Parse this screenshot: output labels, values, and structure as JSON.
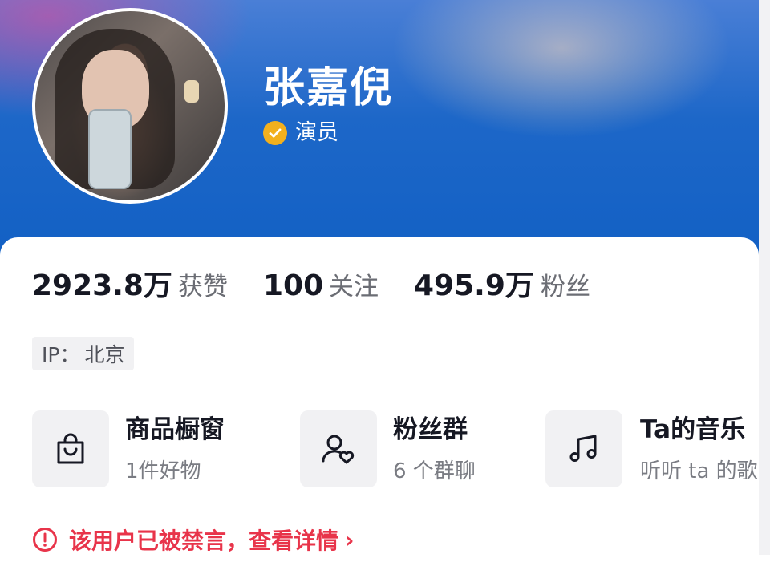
{
  "profile": {
    "name": "张嘉倪",
    "verified_icon": "verified-check-icon",
    "role": "演员"
  },
  "stats": [
    {
      "value": "2923.8万",
      "label": "获赞"
    },
    {
      "value": "100",
      "label": "关注"
    },
    {
      "value": "495.9万",
      "label": "粉丝"
    }
  ],
  "ip": {
    "label": "IP：",
    "value": "北京"
  },
  "tiles": [
    {
      "title": "商品橱窗",
      "subtitle": "1件好物",
      "icon": "shopping-bag-icon"
    },
    {
      "title": "粉丝群",
      "subtitle": "6 个群聊",
      "icon": "fan-group-icon"
    },
    {
      "title": "Ta的音乐",
      "subtitle": "听听 ta 的歌",
      "icon": "music-note-icon"
    }
  ],
  "notice": {
    "text": "该用户已被禁言，查看详情",
    "chevron": "›",
    "icon": "alert-circle-icon"
  },
  "colors": {
    "header_blue": "#1260c4",
    "verified": "#f2b01e",
    "alert_red": "#e8344a",
    "text_dark": "#161823",
    "text_gray": "#6b6d74"
  }
}
